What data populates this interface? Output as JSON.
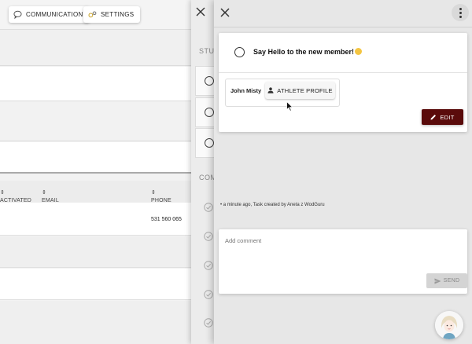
{
  "background": {
    "buttons": {
      "communication": "COMMUNICATION",
      "settings": "SETTINGS"
    },
    "table": {
      "col_activated": "ACTIVATED",
      "col_email": "EMAIL",
      "col_phone": "PHONE",
      "row_phone": "531 560 065"
    }
  },
  "middle_panel": {
    "section_1": "STU",
    "section_2": "COM"
  },
  "task": {
    "title": "Say Hello to the new member!",
    "member_name": "John Misty",
    "athlete_profile_label": "ATHLETE PROFILE",
    "edit_label": "EDIT"
  },
  "activity": {
    "text": "• a minute ago, Task created by Aneta z WodGuru"
  },
  "comment": {
    "placeholder": "Add comment",
    "send_label": "SEND"
  },
  "colors": {
    "edit_button": "#5a0b0b",
    "panel_bg": "#e7e7e7"
  }
}
